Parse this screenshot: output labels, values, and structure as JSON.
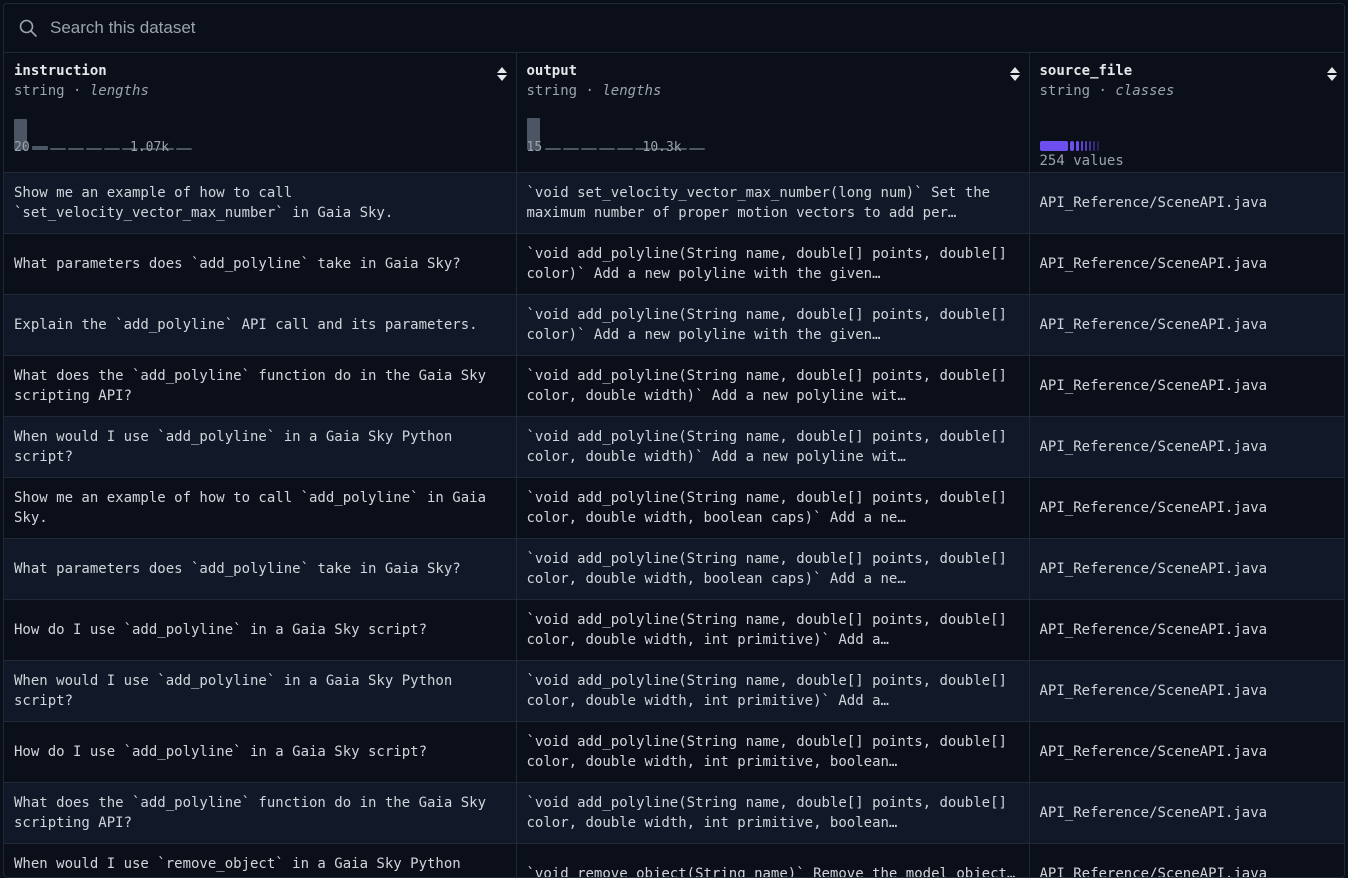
{
  "search": {
    "placeholder": "Search this dataset"
  },
  "columns": [
    {
      "name": "instruction",
      "type": "string",
      "stat_kind": "lengths",
      "hist_min": "20",
      "hist_max": "1.07k",
      "hist_bins": [
        0.9,
        0.12,
        0.05,
        0.03,
        0.02,
        0.02,
        0.02,
        0.02,
        0.01,
        0.01
      ]
    },
    {
      "name": "output",
      "type": "string",
      "stat_kind": "lengths",
      "hist_min": "15",
      "hist_max": "10.3k",
      "hist_bins": [
        0.95,
        0.03,
        0.02,
        0.02,
        0.02,
        0.02,
        0.02,
        0.02,
        0.02,
        0.02
      ]
    },
    {
      "name": "source_file",
      "type": "string",
      "stat_kind": "classes",
      "class_count": "254 values"
    }
  ],
  "type_separator": " · ",
  "rows": [
    {
      "instruction": "Show me an example of how to call `set_velocity_vector_max_number` in Gaia Sky.",
      "output": "`void set_velocity_vector_max_number(long num)` Set the maximum number of proper motion vectors to add per…",
      "source_file": "API_Reference/SceneAPI.java"
    },
    {
      "instruction": "What parameters does `add_polyline` take in Gaia Sky?",
      "output": "`void add_polyline(String name, double[] points, double[] color)` Add a new polyline with the given…",
      "source_file": "API_Reference/SceneAPI.java"
    },
    {
      "instruction": "Explain the `add_polyline` API call and its parameters.",
      "output": "`void add_polyline(String name, double[] points, double[] color)` Add a new polyline with the given…",
      "source_file": "API_Reference/SceneAPI.java"
    },
    {
      "instruction": "What does the `add_polyline` function do in the Gaia Sky scripting API?",
      "output": "`void add_polyline(String name, double[] points, double[] color, double width)` Add a new polyline wit…",
      "source_file": "API_Reference/SceneAPI.java"
    },
    {
      "instruction": "When would I use `add_polyline` in a Gaia Sky Python script?",
      "output": "`void add_polyline(String name, double[] points, double[] color, double width)` Add a new polyline wit…",
      "source_file": "API_Reference/SceneAPI.java"
    },
    {
      "instruction": "Show me an example of how to call `add_polyline` in Gaia Sky.",
      "output": "`void add_polyline(String name, double[] points, double[] color, double width, boolean caps)` Add a ne…",
      "source_file": "API_Reference/SceneAPI.java"
    },
    {
      "instruction": "What parameters does `add_polyline` take in Gaia Sky?",
      "output": "`void add_polyline(String name, double[] points, double[] color, double width, boolean caps)` Add a ne…",
      "source_file": "API_Reference/SceneAPI.java"
    },
    {
      "instruction": "How do I use `add_polyline` in a Gaia Sky script?",
      "output": "`void add_polyline(String name, double[] points, double[] color, double width, int primitive)` Add a…",
      "source_file": "API_Reference/SceneAPI.java"
    },
    {
      "instruction": "When would I use `add_polyline` in a Gaia Sky Python script?",
      "output": "`void add_polyline(String name, double[] points, double[] color, double width, int primitive)` Add a…",
      "source_file": "API_Reference/SceneAPI.java"
    },
    {
      "instruction": "How do I use `add_polyline` in a Gaia Sky script?",
      "output": "`void add_polyline(String name, double[] points, double[] color, double width, int primitive, boolean…",
      "source_file": "API_Reference/SceneAPI.java"
    },
    {
      "instruction": "What does the `add_polyline` function do in the Gaia Sky scripting API?",
      "output": "`void add_polyline(String name, double[] points, double[] color, double width, int primitive, boolean…",
      "source_file": "API_Reference/SceneAPI.java"
    },
    {
      "instruction": "When would I use `remove_object` in a Gaia Sky Python script?",
      "output": "`void remove_object(String name)` Remove the model object…",
      "source_file": "API_Reference/SceneAPI.java"
    }
  ],
  "colors": {
    "accent": "#6d4ff0",
    "bar": "#4b5563",
    "row_alt": "#111827",
    "bg": "#0b0f19"
  }
}
